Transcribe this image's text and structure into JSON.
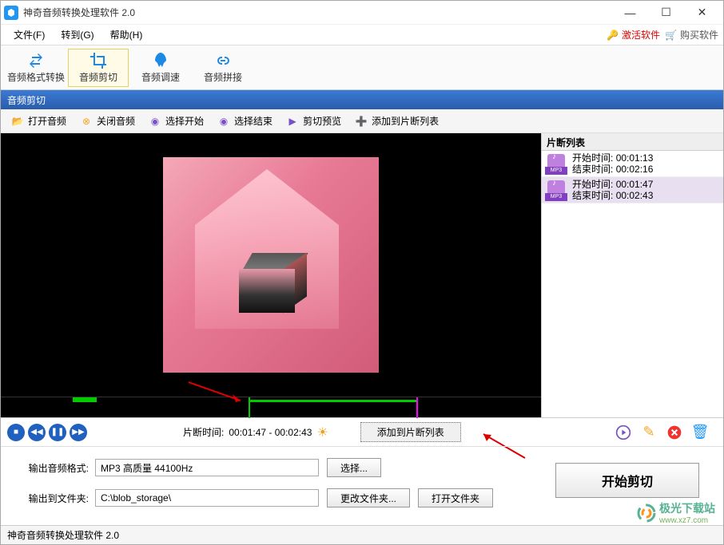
{
  "window": {
    "title": "神奇音频转换处理软件 2.0"
  },
  "menu": {
    "file": "文件(F)",
    "goto": "转到(G)",
    "help": "帮助(H)",
    "activate": "激活软件",
    "buy": "购买软件"
  },
  "toolbar": {
    "format_convert": "音频格式转换",
    "trim": "音频剪切",
    "speed": "音频调速",
    "join": "音频拼接"
  },
  "section": {
    "title": "音频剪切"
  },
  "actions": {
    "open": "打开音频",
    "close": "关闭音频",
    "sel_start": "选择开始",
    "sel_end": "选择结束",
    "preview": "剪切预览",
    "add_list": "添加到片断列表"
  },
  "clips": {
    "header": "片断列表",
    "format_tag": "MP3",
    "start_lbl": "开始时间:",
    "end_lbl": "结束时间:",
    "items": [
      {
        "start": "00:01:13",
        "end": "00:02:16"
      },
      {
        "start": "00:01:47",
        "end": "00:02:43"
      }
    ]
  },
  "segment": {
    "label": "片断时间:",
    "range": "00:01:47 - 00:02:43",
    "add_btn": "添加到片断列表"
  },
  "output": {
    "format_lbl": "输出音频格式:",
    "format_val": "MP3 高质量 44100Hz",
    "select_btn": "选择...",
    "folder_lbl": "输出到文件夹:",
    "folder_val": "C:\\blob_storage\\",
    "change_btn": "更改文件夹...",
    "open_btn": "打开文件夹",
    "start_btn": "开始剪切"
  },
  "status": {
    "text": "神奇音频转换处理软件 2.0"
  },
  "watermark": {
    "name": "极光下载站",
    "url": "www.xz7.com"
  }
}
